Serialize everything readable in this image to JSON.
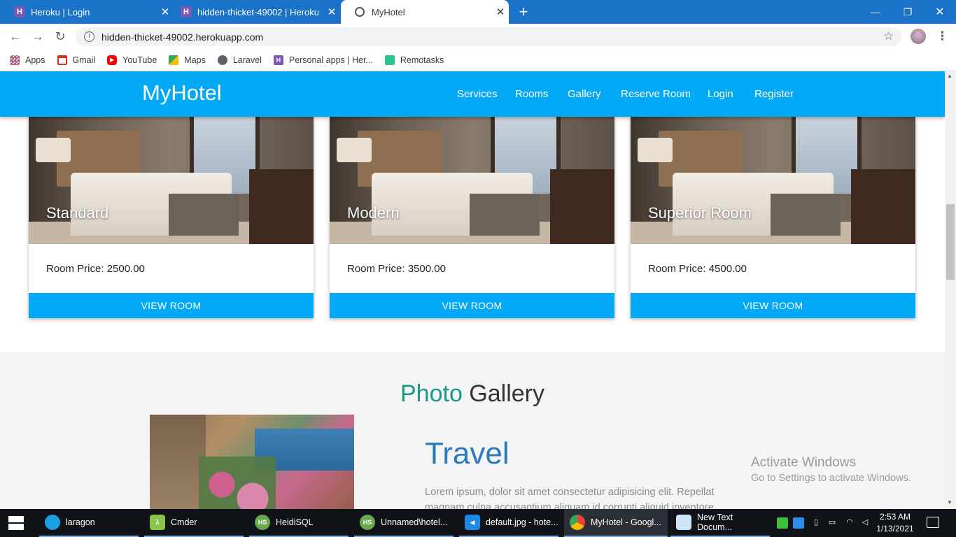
{
  "browser": {
    "tabs": [
      {
        "title": "Heroku | Login",
        "icon": "heroku-icon"
      },
      {
        "title": "hidden-thicket-49002 | Heroku",
        "icon": "heroku-icon"
      },
      {
        "title": "MyHotel",
        "icon": "globe-icon",
        "active": true
      }
    ],
    "new_tab_label": "+",
    "address": "hidden-thicket-49002.herokuapp.com",
    "bookmarks": [
      {
        "label": "Apps",
        "icon": "apps-grid-icon",
        "color": "#e84335"
      },
      {
        "label": "Gmail",
        "icon": "gmail-icon",
        "color": "#d93025"
      },
      {
        "label": "YouTube",
        "icon": "youtube-icon",
        "color": "#ff0000"
      },
      {
        "label": "Maps",
        "icon": "maps-icon",
        "color": "#34a853"
      },
      {
        "label": "Laravel",
        "icon": "globe-icon",
        "color": "#5f6368"
      },
      {
        "label": "Personal apps | Her...",
        "icon": "heroku-icon",
        "color": "#7a59b4"
      },
      {
        "label": "Remotasks",
        "icon": "remotasks-icon",
        "color": "#2bc48a"
      }
    ]
  },
  "site": {
    "brand": "MyHotel",
    "nav": [
      "Services",
      "Rooms",
      "Gallery",
      "Reserve Room",
      "Login",
      "Register"
    ],
    "accent_color": "#03a9f4",
    "rooms": [
      {
        "name": "Standard",
        "price": "Room Price: 2500.00",
        "button": "VIEW ROOM"
      },
      {
        "name": "Modern",
        "price": "Room Price: 3500.00",
        "button": "VIEW ROOM"
      },
      {
        "name": "Superior Room",
        "price": "Room Price: 4500.00",
        "button": "VIEW ROOM"
      }
    ],
    "gallery": {
      "title_accent": "Photo",
      "title_rest": " Gallery",
      "heading": "Travel",
      "text_line1": "Lorem ipsum, dolor sit amet consectetur adipisicing elit. Repellat",
      "text_line2": "magnam culpa accusantium aliquam id corrupti aliquid inventore"
    }
  },
  "watermark": {
    "line1": "Activate Windows",
    "line2": "Go to Settings to activate Windows."
  },
  "taskbar": {
    "apps": [
      {
        "label": "laragon",
        "icon": "laragon-icon"
      },
      {
        "label": "Cmder",
        "icon": "cmder-icon"
      },
      {
        "label": "HeidiSQL",
        "icon": "heidisql-icon",
        "badge": "HS"
      },
      {
        "label": "Unnamed\\hotel...",
        "icon": "heidisql-icon",
        "badge": "HS"
      },
      {
        "label": "default.jpg - hote...",
        "icon": "vscode-icon"
      },
      {
        "label": "MyHotel - Googl...",
        "icon": "chrome-icon"
      },
      {
        "label": "New Text Docum...",
        "icon": "notepad-icon"
      }
    ],
    "time": "2:53 AM",
    "date": "1/13/2021"
  }
}
